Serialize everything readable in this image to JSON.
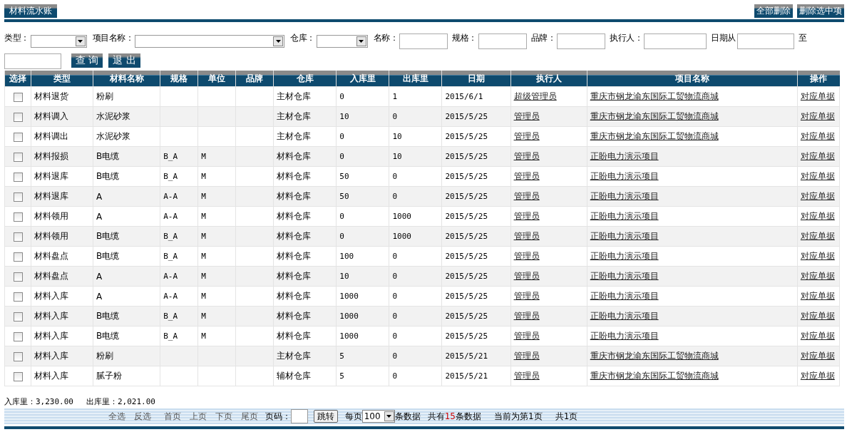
{
  "title": "材料流水账",
  "actions": [
    "全部删除",
    "删除选中项"
  ],
  "filters": [
    {
      "kind": "select",
      "label": "类型："
    },
    {
      "kind": "select",
      "label": "项目名称："
    },
    {
      "kind": "select",
      "label": "仓库："
    },
    {
      "kind": "input",
      "label": "名称："
    },
    {
      "kind": "input",
      "label": "规格："
    },
    {
      "kind": "input",
      "label": "品牌："
    },
    {
      "kind": "input",
      "label": "执行人："
    },
    {
      "kind": "input",
      "label": "日期从"
    },
    {
      "kind": "input",
      "label": "至"
    }
  ],
  "buttons": [
    "查 询",
    "退 出"
  ],
  "table": {
    "columns": [
      "选择",
      "类型",
      "材料名称",
      "规格",
      "单位",
      "品牌",
      "仓库",
      "入库里",
      "出库里",
      "日期",
      "执行人",
      "项目名称",
      "操作"
    ],
    "rows": [
      {
        "checked": false,
        "type": "材料退货",
        "name": "粉刷",
        "spec": "",
        "unit": "",
        "brand": "",
        "warehouse": "主材仓库",
        "in": "0",
        "out": "1",
        "date": "2015/6/1",
        "executor": "超级管理员",
        "project": "重庆市钢龙渝东国际工贸物流商城",
        "action": "对应单据"
      },
      {
        "checked": false,
        "type": "材料调入",
        "name": "水泥砂浆",
        "spec": "",
        "unit": "",
        "brand": "",
        "warehouse": "主材仓库",
        "in": "10",
        "out": "0",
        "date": "2015/5/25",
        "executor": "管理员",
        "project": "重庆市钢龙渝东国际工贸物流商城",
        "action": "对应单据"
      },
      {
        "checked": false,
        "type": "材料调出",
        "name": "水泥砂浆",
        "spec": "",
        "unit": "",
        "brand": "",
        "warehouse": "主材仓库",
        "in": "0",
        "out": "10",
        "date": "2015/5/25",
        "executor": "管理员",
        "project": "重庆市钢龙渝东国际工贸物流商城",
        "action": "对应单据"
      },
      {
        "checked": false,
        "type": "材料报损",
        "name": "B电缆",
        "spec": "B_A",
        "unit": "M",
        "brand": "",
        "warehouse": "材料仓库",
        "in": "0",
        "out": "10",
        "date": "2015/5/25",
        "executor": "管理员",
        "project": "正盼电力演示项目",
        "action": "对应单据"
      },
      {
        "checked": false,
        "type": "材料退库",
        "name": "B电缆",
        "spec": "B_A",
        "unit": "M",
        "brand": "",
        "warehouse": "材料仓库",
        "in": "50",
        "out": "0",
        "date": "2015/5/25",
        "executor": "管理员",
        "project": "正盼电力演示项目",
        "action": "对应单据"
      },
      {
        "checked": false,
        "type": "材料退库",
        "name": "A",
        "spec": "A-A",
        "unit": "M",
        "brand": "",
        "warehouse": "材料仓库",
        "in": "50",
        "out": "0",
        "date": "2015/5/25",
        "executor": "管理员",
        "project": "正盼电力演示项目",
        "action": "对应单据"
      },
      {
        "checked": false,
        "type": "材料领用",
        "name": "A",
        "spec": "A-A",
        "unit": "M",
        "brand": "",
        "warehouse": "材料仓库",
        "in": "0",
        "out": "1000",
        "date": "2015/5/25",
        "executor": "管理员",
        "project": "正盼电力演示项目",
        "action": "对应单据"
      },
      {
        "checked": false,
        "type": "材料领用",
        "name": "B电缆",
        "spec": "B_A",
        "unit": "M",
        "brand": "",
        "warehouse": "材料仓库",
        "in": "0",
        "out": "1000",
        "date": "2015/5/25",
        "executor": "管理员",
        "project": "正盼电力演示项目",
        "action": "对应单据"
      },
      {
        "checked": false,
        "type": "材料盘点",
        "name": "B电缆",
        "spec": "B_A",
        "unit": "M",
        "brand": "",
        "warehouse": "材料仓库",
        "in": "100",
        "out": "0",
        "date": "2015/5/25",
        "executor": "管理员",
        "project": "正盼电力演示项目",
        "action": "对应单据"
      },
      {
        "checked": false,
        "type": "材料盘点",
        "name": "A",
        "spec": "A-A",
        "unit": "M",
        "brand": "",
        "warehouse": "材料仓库",
        "in": "10",
        "out": "0",
        "date": "2015/5/25",
        "executor": "管理员",
        "project": "正盼电力演示项目",
        "action": "对应单据"
      },
      {
        "checked": false,
        "type": "材料入库",
        "name": "A",
        "spec": "A-A",
        "unit": "M",
        "brand": "",
        "warehouse": "材料仓库",
        "in": "1000",
        "out": "0",
        "date": "2015/5/25",
        "executor": "管理员",
        "project": "正盼电力演示项目",
        "action": "对应单据"
      },
      {
        "checked": false,
        "type": "材料入库",
        "name": "B电缆",
        "spec": "B_A",
        "unit": "M",
        "brand": "",
        "warehouse": "材料仓库",
        "in": "1000",
        "out": "0",
        "date": "2015/5/25",
        "executor": "管理员",
        "project": "正盼电力演示项目",
        "action": "对应单据"
      },
      {
        "checked": false,
        "type": "材料入库",
        "name": "B电缆",
        "spec": "B_A",
        "unit": "M",
        "brand": "",
        "warehouse": "材料仓库",
        "in": "1000",
        "out": "0",
        "date": "2015/5/25",
        "executor": "管理员",
        "project": "正盼电力演示项目",
        "action": "对应单据"
      },
      {
        "checked": false,
        "type": "材料入库",
        "name": "粉刷",
        "spec": "",
        "unit": "",
        "brand": "",
        "warehouse": "主材仓库",
        "in": "5",
        "out": "0",
        "date": "2015/5/21",
        "executor": "管理员",
        "project": "重庆市钢龙渝东国际工贸物流商城",
        "action": "对应单据"
      },
      {
        "checked": false,
        "type": "材料入库",
        "name": "腻子粉",
        "spec": "",
        "unit": "",
        "brand": "",
        "warehouse": "辅材仓库",
        "in": "5",
        "out": "0",
        "date": "2015/5/21",
        "executor": "管理员",
        "project": "重庆市钢龙渝东国际工贸物流商城",
        "action": "对应单据"
      }
    ]
  },
  "totals": [
    "入库里：3,230.00",
    "出库里：2,021.00"
  ],
  "pager": {
    "links": [
      "全选",
      "反选",
      "首页",
      "上页",
      "下页",
      "尾页"
    ],
    "page_label": "页码：",
    "jump": "跳转",
    "per_page_label": "每页",
    "per_page": "100",
    "per_page_suffix": "条数据",
    "total_prefix": "共有",
    "total_count": "15",
    "total_suffix": "条数据",
    "current": "当前为第1页",
    "pages": "共1页"
  }
}
